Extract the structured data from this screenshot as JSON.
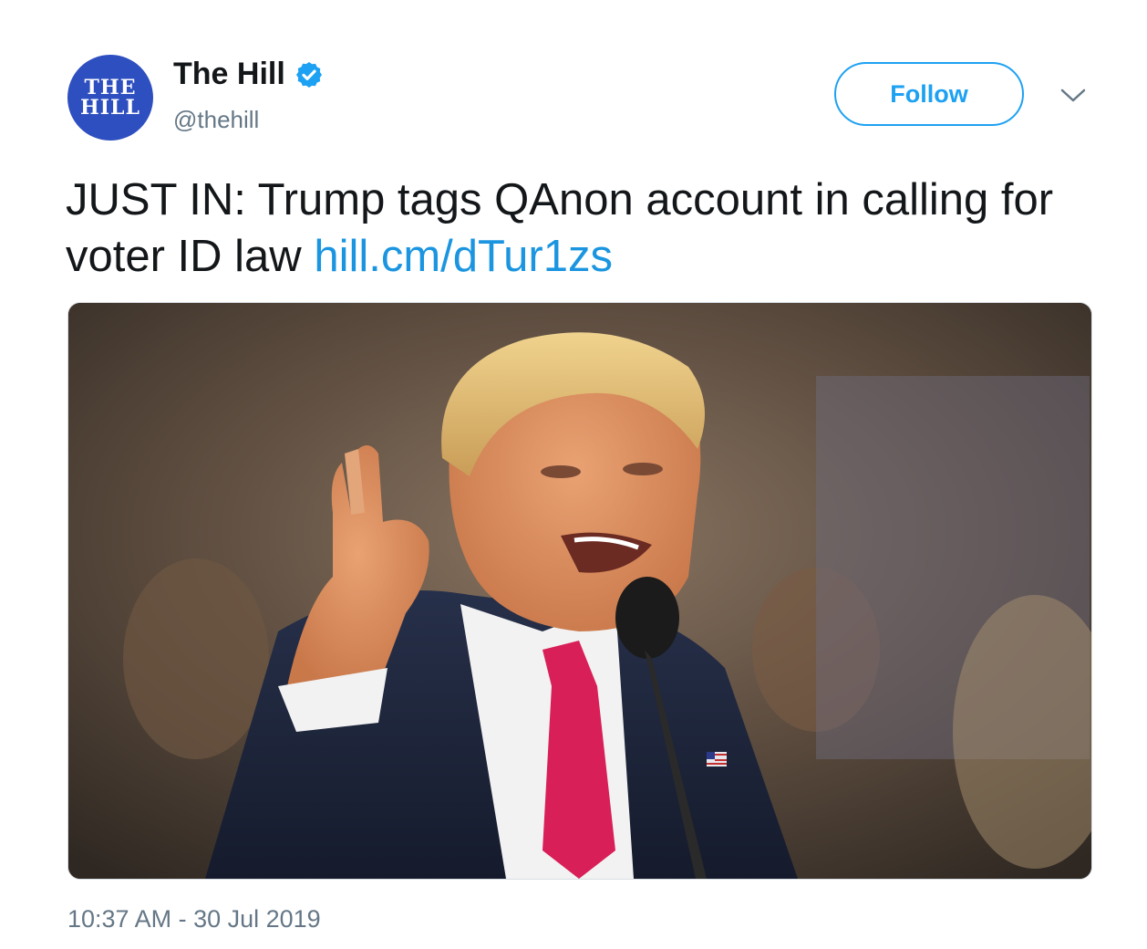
{
  "account": {
    "avatar_line1": "THE",
    "avatar_line2": "HILL",
    "display_name": "The Hill",
    "handle": "@thehill",
    "verified": true
  },
  "actions": {
    "follow_label": "Follow",
    "menu_icon": "chevron-down-icon"
  },
  "tweet": {
    "text": "JUST IN: Trump tags QAnon account in calling for voter ID law",
    "link": "hill.cm/dTur1zs",
    "timestamp": "10:37 AM - 30 Jul 2019"
  },
  "colors": {
    "accent": "#1da1f2",
    "link": "#1b95e0",
    "avatar_bg": "#2e4fbf",
    "secondary_text": "#657786"
  }
}
